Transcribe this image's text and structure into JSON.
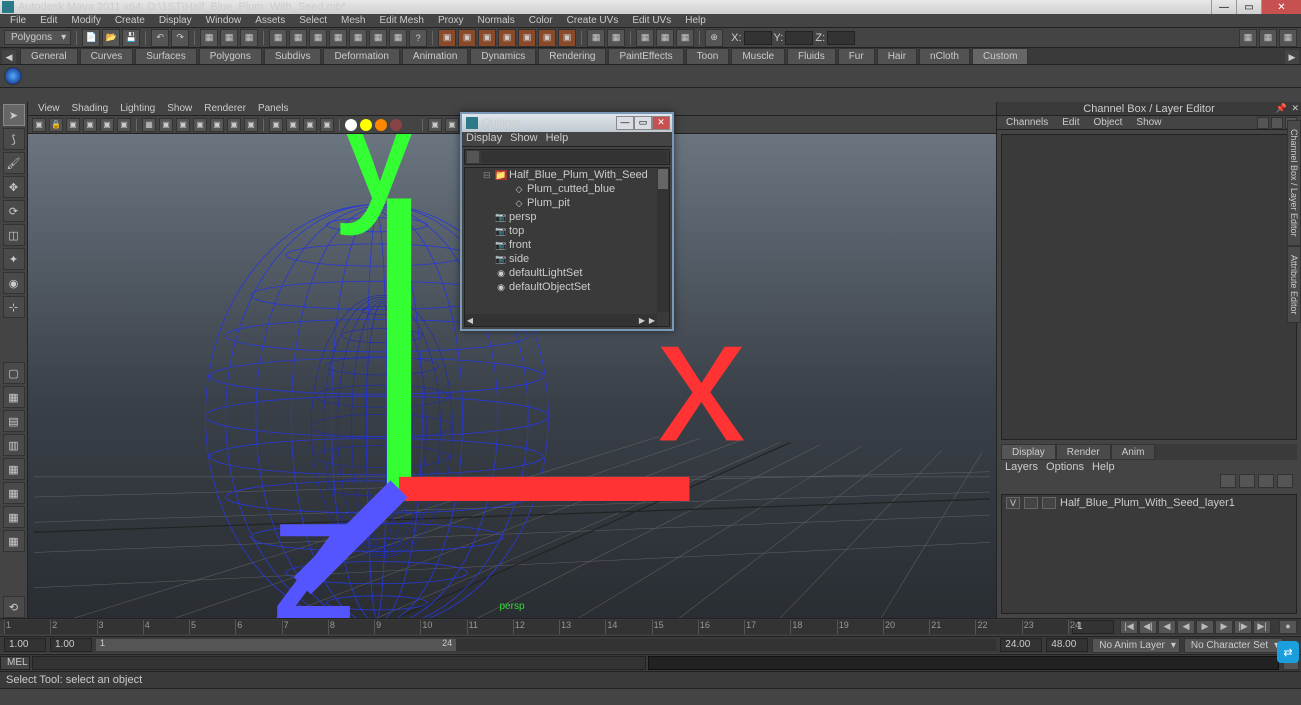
{
  "titlebar": {
    "text": "Autodesk Maya 2011 x64: D:\\1ST\\Half_Blue_Plum_With_Seed.mb*"
  },
  "menubar": [
    "File",
    "Edit",
    "Modify",
    "Create",
    "Display",
    "Window",
    "Assets",
    "Select",
    "Mesh",
    "Edit Mesh",
    "Proxy",
    "Normals",
    "Color",
    "Create UVs",
    "Edit UVs",
    "Help"
  ],
  "module_dropdown": "Polygons",
  "coords": {
    "x": "X:",
    "y": "Y:",
    "z": "Z:"
  },
  "tabs": [
    "General",
    "Curves",
    "Surfaces",
    "Polygons",
    "Subdivs",
    "Deformation",
    "Animation",
    "Dynamics",
    "Rendering",
    "PaintEffects",
    "Toon",
    "Muscle",
    "Fluids",
    "Fur",
    "Hair",
    "nCloth",
    "Custom"
  ],
  "active_tab": "Custom",
  "viewport_menu": [
    "View",
    "Shading",
    "Lighting",
    "Show",
    "Renderer",
    "Panels"
  ],
  "persp_label": "persp",
  "right_panel": {
    "title": "Channel Box / Layer Editor",
    "chan_menu": [
      "Channels",
      "Edit",
      "Object",
      "Show"
    ],
    "layer_tabs": [
      "Display",
      "Render",
      "Anim"
    ],
    "layer_tabs_active": "Display",
    "layer_menu": [
      "Layers",
      "Options",
      "Help"
    ],
    "layer_row": {
      "vis": "V",
      "name": "Half_Blue_Plum_With_Seed_layer1"
    },
    "side_tabs": [
      "Channel Box / Layer Editor",
      "Attribute Editor"
    ]
  },
  "outliner": {
    "title": "Outliner",
    "menu": [
      "Display",
      "Show",
      "Help"
    ],
    "items": [
      {
        "indent": 0,
        "icon": "group",
        "label": "Half_Blue_Plum_With_Seed",
        "expanded": true,
        "sel": true
      },
      {
        "indent": 1,
        "icon": "mesh",
        "label": "Plum_cutted_blue"
      },
      {
        "indent": 1,
        "icon": "mesh",
        "label": "Plum_pit"
      },
      {
        "indent": 0,
        "icon": "cam",
        "label": "persp",
        "dim": true
      },
      {
        "indent": 0,
        "icon": "cam",
        "label": "top",
        "dim": true
      },
      {
        "indent": 0,
        "icon": "cam",
        "label": "front",
        "dim": true
      },
      {
        "indent": 0,
        "icon": "cam",
        "label": "side",
        "dim": true
      },
      {
        "indent": 0,
        "icon": "set",
        "label": "defaultLightSet"
      },
      {
        "indent": 0,
        "icon": "set",
        "label": "defaultObjectSet"
      }
    ]
  },
  "time": {
    "ticks": [
      1,
      2,
      3,
      4,
      5,
      6,
      7,
      8,
      9,
      10,
      11,
      12,
      13,
      14,
      15,
      16,
      17,
      18,
      19,
      20,
      21,
      22,
      23,
      24
    ],
    "current": "1",
    "range_start": "1.00",
    "range_start2": "1.00",
    "range_end": "24.00",
    "range_end2": "48.00",
    "anim_layer": "No Anim Layer",
    "char_set": "No Character Set",
    "rbar_label": "24",
    "rbar_start": "1"
  },
  "cmd": {
    "lang": "MEL"
  },
  "help": "Select Tool: select an object"
}
